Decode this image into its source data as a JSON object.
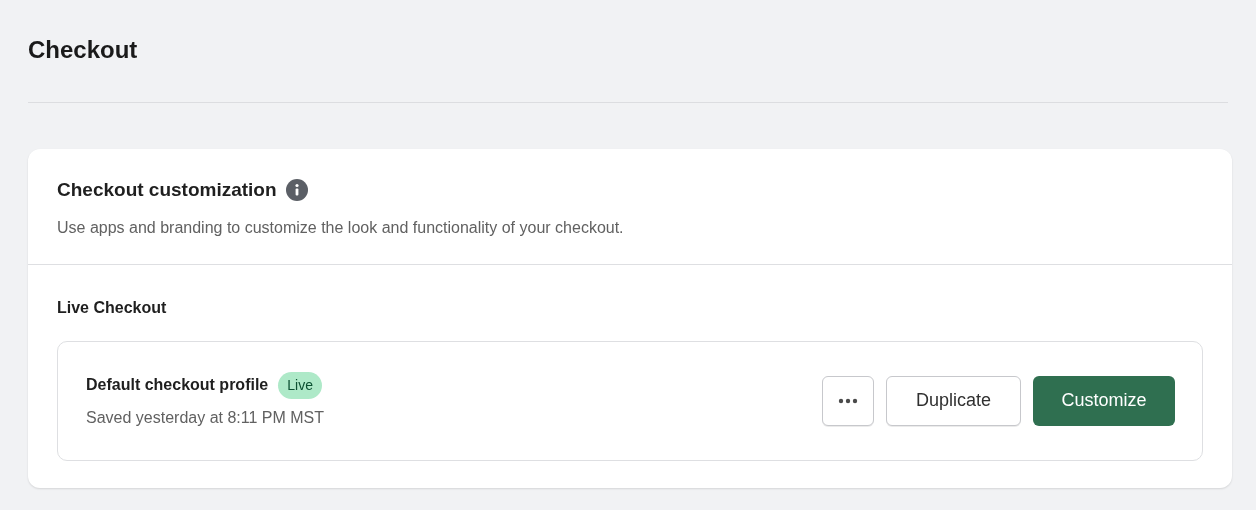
{
  "page": {
    "title": "Checkout"
  },
  "card": {
    "title": "Checkout customization",
    "description": "Use apps and branding to customize the look and functionality of your checkout.",
    "section_title": "Live Checkout",
    "profile": {
      "name": "Default checkout profile",
      "badge": "Live",
      "saved": "Saved yesterday at 8:11 PM MST"
    },
    "buttons": [
      {
        "kind": "more"
      },
      {
        "kind": "secondary",
        "label": "Duplicate"
      },
      {
        "kind": "primary",
        "label": "Customize"
      }
    ]
  }
}
